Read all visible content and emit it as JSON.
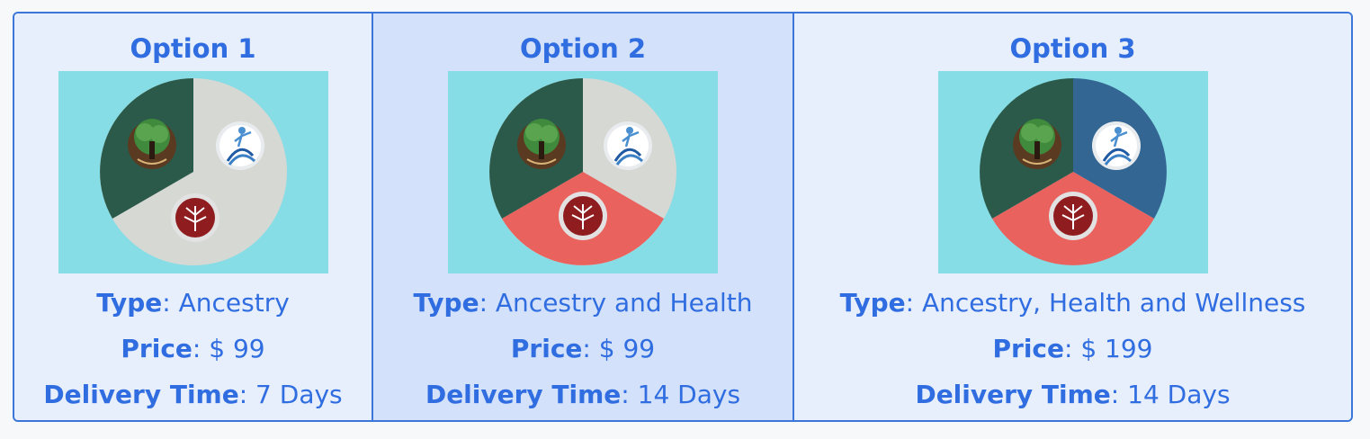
{
  "options": [
    {
      "title": "Option 1",
      "type_label": "Type",
      "type_value": ": Ancestry",
      "price_label": "Price",
      "price_value": ": $ 99",
      "delivery_label": "Delivery Time",
      "delivery_value": ": 7 Days"
    },
    {
      "title": "Option 2",
      "type_label": "Type",
      "type_value": ": Ancestry and Health",
      "price_label": "Price",
      "price_value": ": $ 99",
      "delivery_label": "Delivery Time",
      "delivery_value": ": 14 Days"
    },
    {
      "title": "Option 3",
      "type_label": "Type",
      "type_value": ": Ancestry, Health and Wellness",
      "price_label": "Price",
      "price_value": ": $ 199",
      "delivery_label": "Delivery Time",
      "delivery_value": ": 14 Days"
    }
  ],
  "colors": {
    "accent": "#2f6de0",
    "border": "#3b76d8",
    "image_bg": "#86dde5",
    "ancestry_slice": "#2b5a4b",
    "health_slice": "#ea625e",
    "wellness_slice": "#346694",
    "inactive_slice": "#d6d8d4"
  },
  "icons": [
    "ancestry-tree-icon",
    "wellness-figure-icon",
    "health-tree-icon"
  ]
}
